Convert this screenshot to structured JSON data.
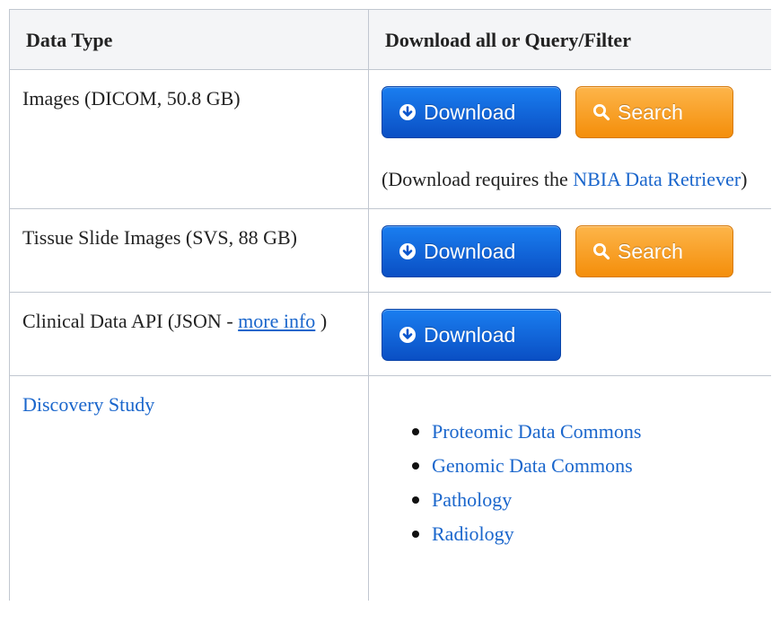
{
  "table": {
    "header": {
      "col1": "Data Type",
      "col2": "Download all or Query/Filter"
    },
    "rows": [
      {
        "label": "Images (DICOM, 50.8 GB)",
        "download_label": "Download",
        "search_label": "Search",
        "note_prefix": "(Download requires the ",
        "note_link": "NBIA Data Retriever",
        "note_suffix": ")"
      },
      {
        "label": "Tissue Slide Images (SVS, 88 GB)",
        "download_label": "Download",
        "search_label": "Search"
      },
      {
        "label_prefix": "Clinical Data API (JSON - ",
        "label_link": "more info",
        "label_suffix": " )",
        "download_label": "Download"
      },
      {
        "label_link": "Discovery Study",
        "links": [
          "Proteomic Data Commons",
          "Genomic Data Commons",
          "Pathology",
          "Radiology"
        ]
      }
    ]
  },
  "icons": {
    "download": "arrow-down-circle-icon",
    "search": "magnifier-icon"
  },
  "colors": {
    "link": "#1a66cc",
    "download_button": "#0a5fd8",
    "search_button": "#f7a024",
    "header_bg": "#f4f5f7",
    "border": "#c1c7d0"
  }
}
